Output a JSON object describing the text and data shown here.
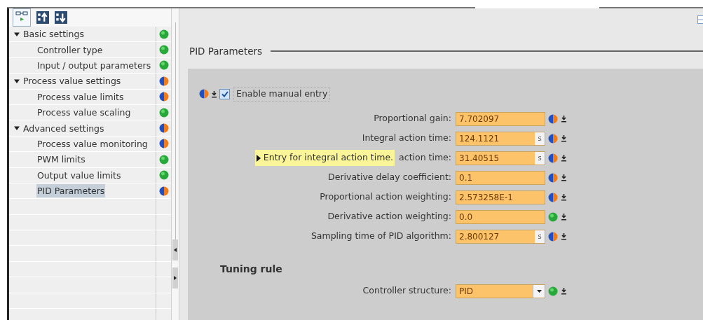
{
  "tree": [
    {
      "label": "Basic settings",
      "status": {
        "kind": "ok"
      },
      "expanded": true,
      "selected": false,
      "children": [
        {
          "label": "Controller type",
          "status": {
            "kind": "ok"
          },
          "selected": false
        },
        {
          "label": "Input / output parameters",
          "status": {
            "kind": "ok"
          },
          "selected": false
        }
      ]
    },
    {
      "label": "Process value settings",
      "status": {
        "kind": "mixed"
      },
      "expanded": true,
      "selected": false,
      "children": [
        {
          "label": "Process value limits",
          "status": {
            "kind": "mixed"
          },
          "selected": false
        },
        {
          "label": "Process value scaling",
          "status": {
            "kind": "ok"
          },
          "selected": false
        }
      ]
    },
    {
      "label": "Advanced settings",
      "status": {
        "kind": "mixed"
      },
      "expanded": true,
      "selected": false,
      "children": [
        {
          "label": "Process value monitoring",
          "status": {
            "kind": "mixed"
          },
          "selected": false
        },
        {
          "label": "PWM limits",
          "status": {
            "kind": "ok"
          },
          "selected": false
        },
        {
          "label": "Output value limits",
          "status": {
            "kind": "ok"
          },
          "selected": false
        },
        {
          "label": "PID Parameters",
          "status": {
            "kind": "mixed"
          },
          "selected": true
        }
      ]
    }
  ],
  "section_title": "PID Parameters",
  "manual_entry": {
    "label": "Enable manual entry",
    "checked": true,
    "status": {
      "kind": "mixed"
    }
  },
  "parameters": [
    {
      "label": "Proportional gain:",
      "value": "7.702097",
      "status": {
        "kind": "mixed"
      }
    },
    {
      "label": "Integral action time:",
      "value": "124.1121",
      "unit": "s",
      "status": {
        "kind": "mixed"
      }
    },
    {
      "label": "action time:",
      "tooltip": "Entry for integral action time.",
      "value": "31.40515",
      "unit": "s",
      "status": {
        "kind": "mixed"
      }
    },
    {
      "label": "Derivative delay coefficient:",
      "value": "0.1",
      "status": {
        "kind": "mixed"
      }
    },
    {
      "label": "Proportional action weighting:",
      "value": "2.573258E-1",
      "status": {
        "kind": "mixed"
      }
    },
    {
      "label": "Derivative action weighting:",
      "value": "0.0",
      "status": {
        "kind": "ok"
      }
    },
    {
      "label": "Sampling time of PID algorithm:",
      "value": "2.800127",
      "unit": "s",
      "status": {
        "kind": "mixed"
      }
    }
  ],
  "tuning": {
    "title": "Tuning rule",
    "fields": [
      {
        "label": "Controller structure:",
        "value": "PID",
        "kind": "dropdown",
        "status": {
          "kind": "ok"
        }
      }
    ]
  }
}
